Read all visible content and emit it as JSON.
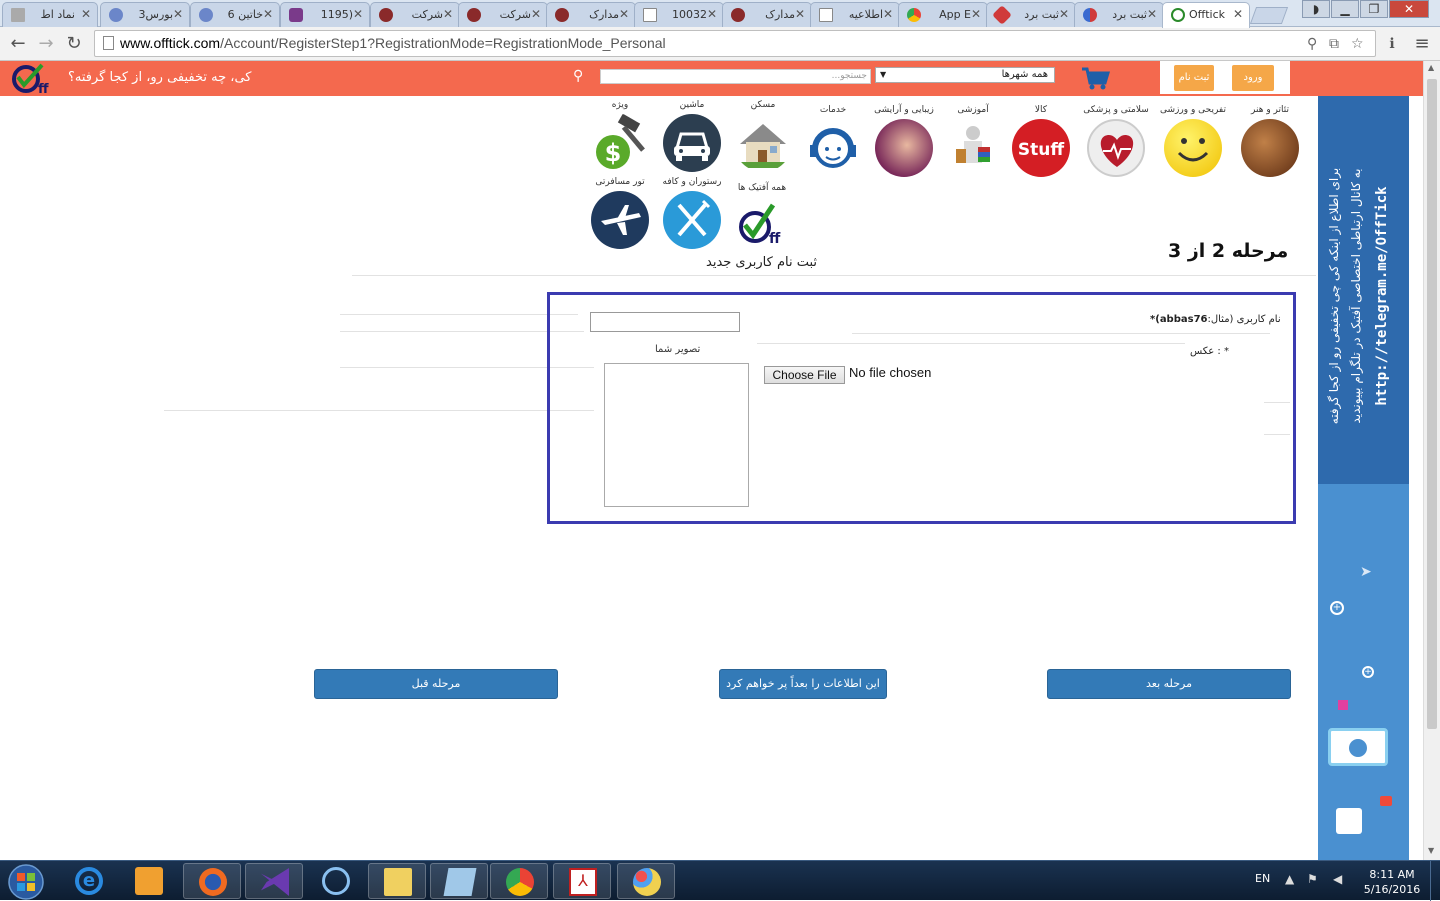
{
  "browser": {
    "tabs": [
      {
        "label": "نماد اط",
        "color": "#888888"
      },
      {
        "label": "بورس3",
        "color": "#6b86c9"
      },
      {
        "label": "خاتین 6",
        "color": "#6b86c9"
      },
      {
        "label": "(1195",
        "color": "#7a3a8a"
      },
      {
        "label": "شرکت",
        "color": "#8a2a2a"
      },
      {
        "label": "شرکت",
        "color": "#8a2a2a"
      },
      {
        "label": "مدارک",
        "color": "#8a2a2a"
      },
      {
        "label": "10032",
        "color": "#888888"
      },
      {
        "label": "مدارک",
        "color": "#8a2a2a"
      },
      {
        "label": "اطلاعیه",
        "color": "#888888"
      },
      {
        "label": "App E",
        "color": "#4a8ad0"
      },
      {
        "label": "ثبت برد",
        "color": "#d03a3a"
      },
      {
        "label": "ثبت برد",
        "color": "#3a6ad0"
      },
      {
        "label": "Offtick",
        "color": "#2a8a2a"
      }
    ],
    "url_host": "www.offtick.com",
    "url_path": "/Account/RegisterStep1?RegistrationMode=RegistrationMode_Personal"
  },
  "header": {
    "tagline": "کی، چه تخفیفی رو، از کجا گرفته؟",
    "search_placeholder": "جستجو...",
    "city_select": "همه شهرها",
    "register_label": "ثبت نام",
    "login_label": "ورود",
    "accent_color": "#f4694e"
  },
  "categories": [
    {
      "label": "تئاتر و هنر"
    },
    {
      "label": "تفریحی و ورزشی"
    },
    {
      "label": "سلامتی و پزشکی"
    },
    {
      "label": "کالا"
    },
    {
      "label": "آموزشی"
    },
    {
      "label": "زیبایی و آرایشی"
    },
    {
      "label": "خدمات"
    },
    {
      "label": "مسکن"
    },
    {
      "label": "ماشین"
    },
    {
      "label": "ویژه"
    },
    {
      "label": "همه آفتیک ها"
    },
    {
      "label": "رستوران و کافه"
    },
    {
      "label": "تور مسافرتی"
    }
  ],
  "form": {
    "step_title": "مرحله 2 از 3",
    "title": "ثبت نام کاربری جدید",
    "username_label": "نام کاربری (مثال:",
    "username_example": "abbas76",
    "username_suffix": ")*",
    "username_value": "",
    "photo_label": "* : عکس",
    "photo_caption": "تصویر شما",
    "choose_file_label": "Choose File",
    "no_file_text": "No file chosen"
  },
  "buttons": {
    "prev": "مرحله قبل",
    "later": "این اطلاعات را بعداً پر خواهم کرد",
    "next": "مرحله بعد"
  },
  "banner": {
    "line1": "برای اطلاع از اینکه کی چی تخفیفی رو از کجا گرفته",
    "line2": "به کانال ارتباطی اختصاصی آفتیک در تلگرام بپیوندید",
    "link": "http://telegram.me/OffTick"
  },
  "taskbar": {
    "lang": "EN",
    "time": "8:11 AM",
    "date": "5/16/2016"
  }
}
